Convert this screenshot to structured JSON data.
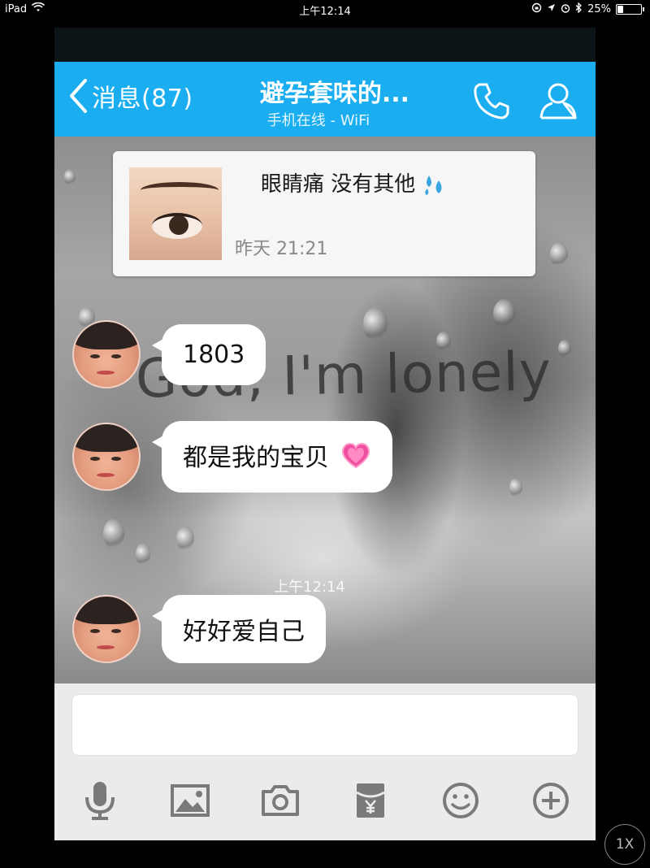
{
  "status_bar": {
    "device": "iPad",
    "time": "上午12:14",
    "battery": "25%",
    "battery_level": 0.25,
    "icons": [
      "wifi-icon",
      "rotation-lock-icon",
      "location-icon",
      "alarm-icon",
      "bluetooth-icon",
      "battery-icon"
    ]
  },
  "nav": {
    "back_label": "消息(87)",
    "title": "避孕套味的...",
    "subtitle": "手机在线 - WiFi",
    "colors": {
      "bar": "#1aadf0",
      "text": "#ffffff"
    },
    "icons": [
      "back-chevron-icon",
      "phone-icon",
      "profile-icon"
    ]
  },
  "chat": {
    "background_text": "God, I'm lonely",
    "post_card": {
      "text": "眼睛痛 没有其他",
      "emoji": "sweat-droplets-icon",
      "time": "昨天 21:21"
    },
    "timestamp": "上午12:14",
    "messages": [
      {
        "text": "1803"
      },
      {
        "text": "都是我的宝贝",
        "emoji": "sparkling-heart-icon"
      },
      {
        "text": "好好爱自己"
      }
    ]
  },
  "composer": {
    "placeholder": "",
    "tools": [
      "microphone-icon",
      "image-icon",
      "camera-icon",
      "red-packet-icon",
      "emoji-icon",
      "plus-icon"
    ]
  },
  "overlay": {
    "speed_label": "1X"
  }
}
